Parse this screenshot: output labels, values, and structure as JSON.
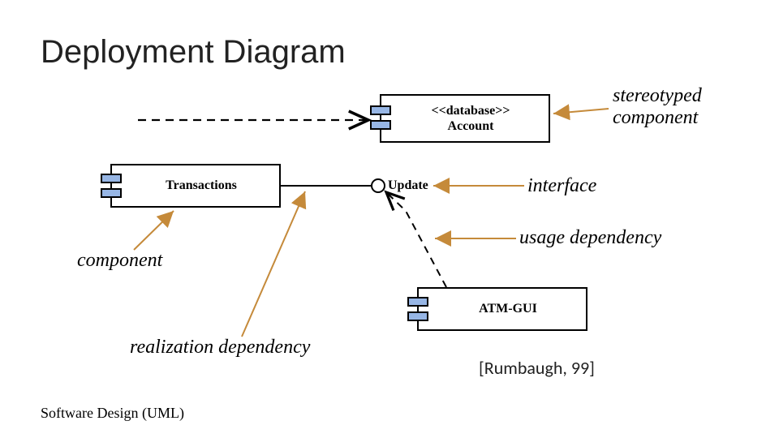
{
  "title": "Deployment Diagram",
  "components": {
    "account": {
      "stereotype": "<<database>>",
      "name": "Account"
    },
    "transactions": {
      "name": "Transactions"
    },
    "atmgui": {
      "name": "ATM-GUI"
    }
  },
  "interface": {
    "name": "Update"
  },
  "labels": {
    "stereotyped": "stereotyped",
    "component1": "component",
    "interface": "interface",
    "usage": "usage dependency",
    "component2": "component",
    "realization": "realization dependency"
  },
  "citation": "[Rumbaugh, 99]",
  "footer": "Software Design (UML)",
  "colors": {
    "tabFill": "#97b6e5",
    "annotate": "#c58a3a"
  }
}
